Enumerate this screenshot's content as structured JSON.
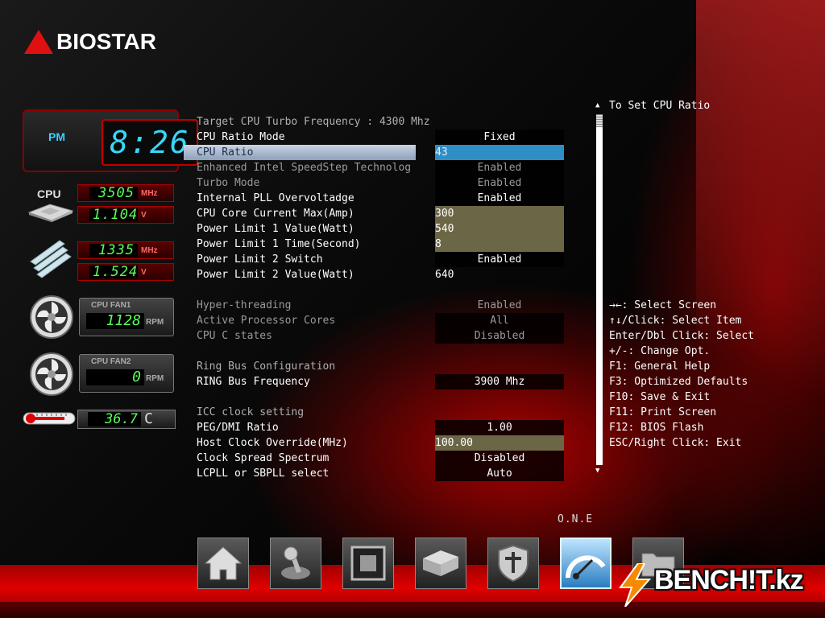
{
  "brand": {
    "name": "BIOSTAR"
  },
  "clock": {
    "ampm": "PM",
    "time": "8:26"
  },
  "monitor": {
    "cpu_label": "CPU",
    "cpu_freq": {
      "value": "3505",
      "unit": "MHz"
    },
    "cpu_volt": {
      "value": "1.104",
      "unit": "V"
    },
    "mem_freq": {
      "value": "1335",
      "unit": "MHz"
    },
    "mem_volt": {
      "value": "1.524",
      "unit": "V"
    },
    "fan1": {
      "name": "CPU FAN1",
      "value": "1128",
      "unit": "RPM"
    },
    "fan2": {
      "name": "CPU FAN2",
      "value": "0",
      "unit": "RPM"
    },
    "temp": {
      "value": "36.7",
      "unit": "C"
    }
  },
  "settings": {
    "rows": [
      {
        "label": "Target CPU Turbo Frequency : 4300 Mhz",
        "value": ""
      },
      {
        "label": "CPU Ratio Mode",
        "value": "Fixed"
      },
      {
        "label": "CPU Ratio",
        "value": "43"
      },
      {
        "label": "Enhanced Intel SpeedStep Technolog",
        "value": "Enabled"
      },
      {
        "label": "Turbo Mode",
        "value": "Enabled"
      },
      {
        "label": "Internal PLL Overvoltadge",
        "value": "Enabled"
      },
      {
        "label": "CPU Core Current Max(Amp)",
        "value": "300"
      },
      {
        "label": "Power Limit 1 Value(Watt)",
        "value": "540"
      },
      {
        "label": "Power Limit 1 Time(Second)",
        "value": "8"
      },
      {
        "label": "Power Limit 2 Switch",
        "value": "Enabled"
      },
      {
        "label": "Power Limit 2 Value(Watt)",
        "value": "640"
      },
      {
        "label": "Hyper-threading",
        "value": "Enabled"
      },
      {
        "label": "Active Processor Cores",
        "value": "All"
      },
      {
        "label": "CPU C states",
        "value": "Disabled"
      },
      {
        "label": "Ring Bus Configuration",
        "value": ""
      },
      {
        "label": "RING Bus Frequency",
        "value": "3900 Mhz"
      },
      {
        "label": "ICC clock setting",
        "value": ""
      },
      {
        "label": "PEG/DMI Ratio",
        "value": "1.00"
      },
      {
        "label": "Host Clock Override(MHz)",
        "value": "100.00"
      },
      {
        "label": "Clock Spread Spectrum",
        "value": "Disabled"
      },
      {
        "label": "LCPLL or SBPLL select",
        "value": "Auto"
      }
    ]
  },
  "help": {
    "title": "To Set CPU Ratio",
    "keys": [
      "→←: Select Screen",
      "↑↓/Click: Select Item",
      "Enter/Dbl Click: Select",
      "+/-: Change Opt.",
      "F1: General Help",
      "F3: Optimized Defaults",
      "F10: Save & Exit",
      "F11: Print Screen",
      "F12: BIOS Flash",
      "ESC/Right Click: Exit"
    ]
  },
  "nav": {
    "active_label": "O.N.E",
    "icons": [
      "home-icon",
      "joystick-icon",
      "chipset-icon",
      "storage-icon",
      "security-shield-icon",
      "one-speedometer-icon",
      "folder-icon"
    ]
  },
  "watermark": {
    "text": "BENCH!T.kz"
  }
}
